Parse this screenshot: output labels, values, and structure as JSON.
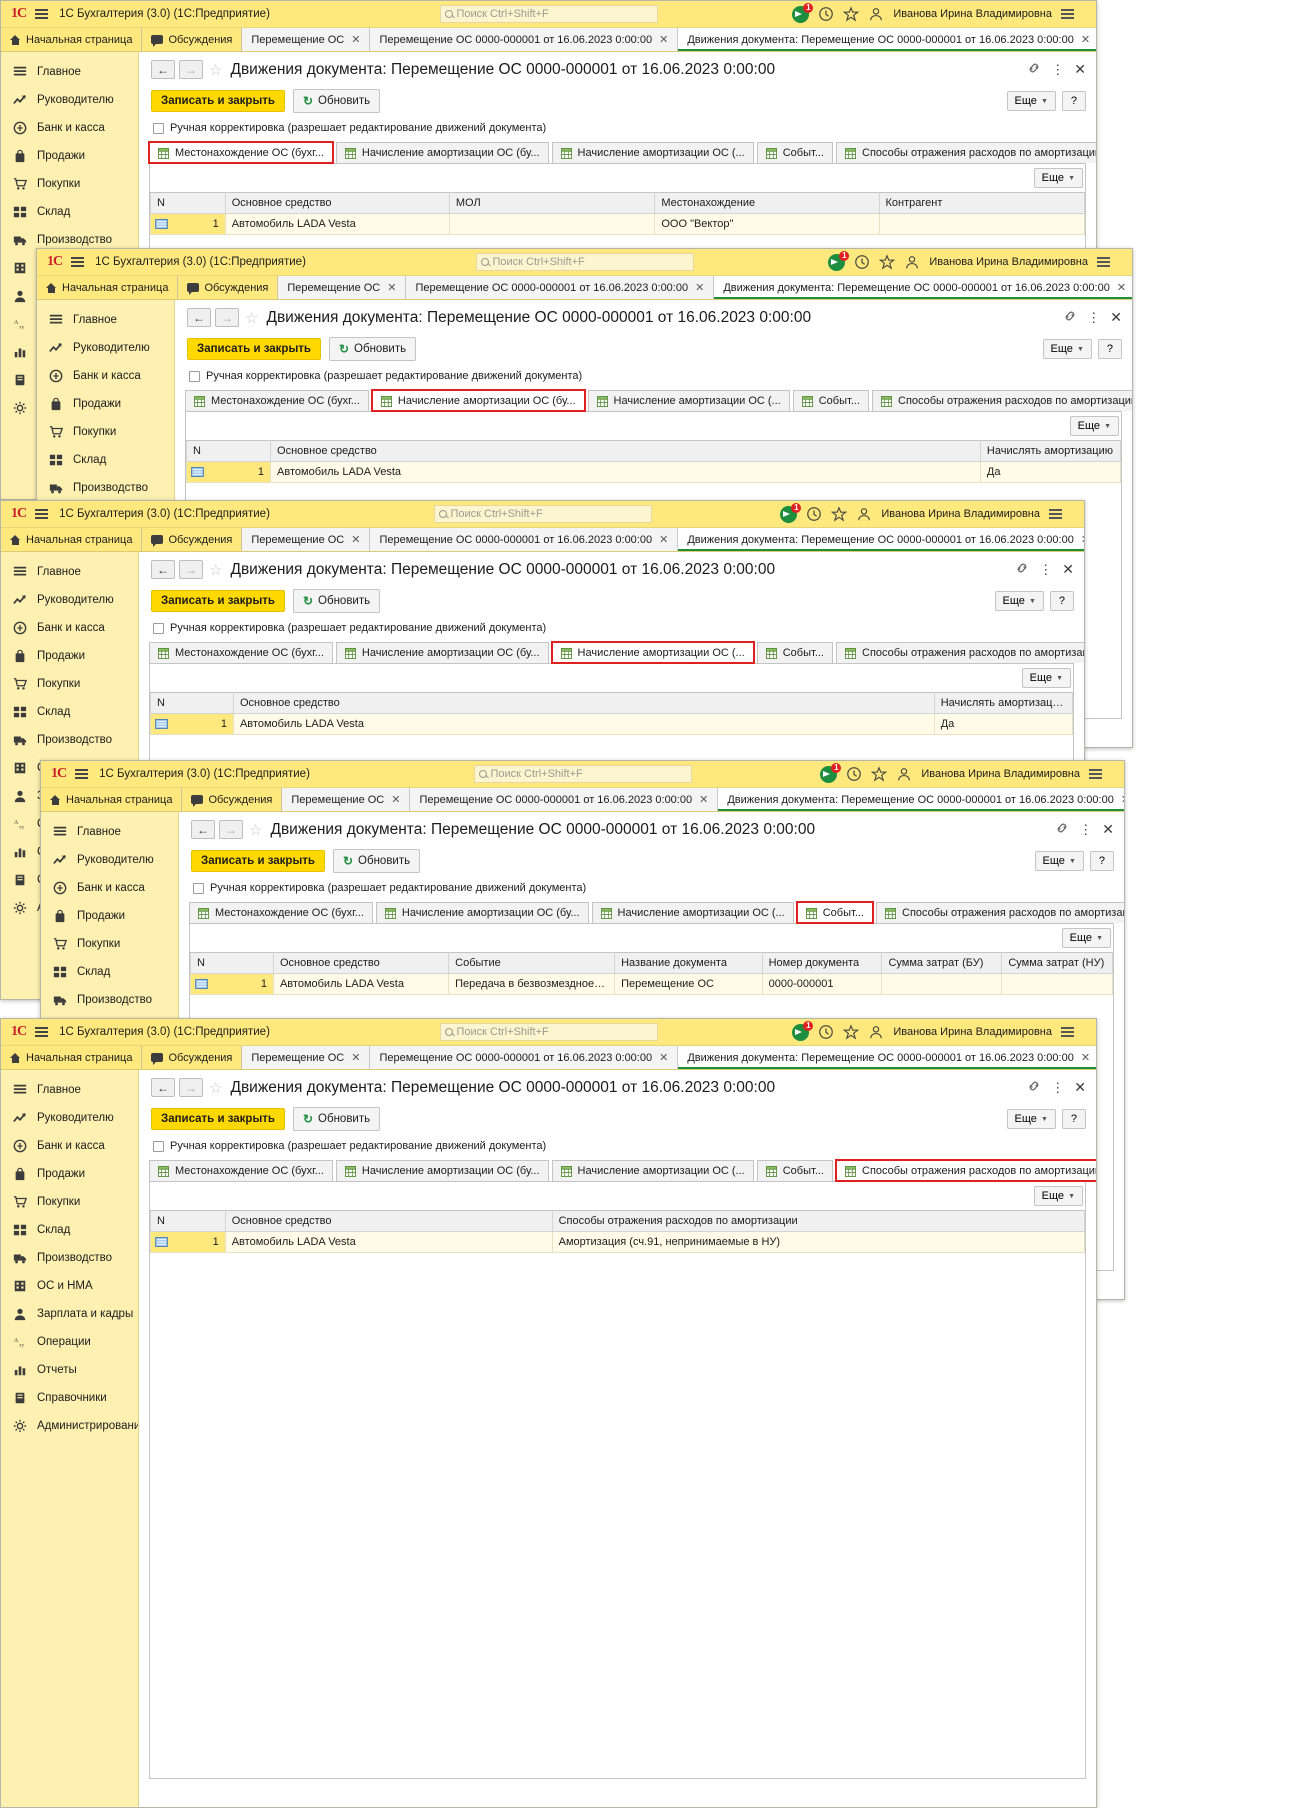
{
  "app": {
    "logo": "1C",
    "title": "1С Бухгалтерия (3.0)  (1С:Предприятие)",
    "search_placeholder": "Поиск Ctrl+Shift+F",
    "notification_count": "1",
    "username": "Иванова Ирина Владимировна",
    "icons": {
      "menu": "burger-menu-icon",
      "notification": "notification-megaphone-icon",
      "history": "history-clock-icon",
      "favorites": "star-icon",
      "user": "user-icon",
      "main_menu": "main-menu-icon"
    }
  },
  "tabs": [
    {
      "label": "Начальная страница",
      "icon": "home-icon",
      "closable": false,
      "state": "plain"
    },
    {
      "label": "Обсуждения",
      "icon": "chat-icon",
      "closable": false,
      "state": "plain"
    },
    {
      "label": "Перемещение ОС",
      "icon": "",
      "closable": true,
      "state": "page"
    },
    {
      "label": "Перемещение ОС 0000-000001 от 16.06.2023 0:00:00",
      "icon": "",
      "closable": true,
      "state": "page"
    },
    {
      "label": "Движения документа: Перемещение ОС 0000-000001 от 16.06.2023 0:00:00",
      "icon": "",
      "closable": true,
      "state": "active"
    }
  ],
  "sidebar": {
    "items": [
      {
        "label": "Главное",
        "icon": "list-icon"
      },
      {
        "label": "Руководителю",
        "icon": "trend-up-icon"
      },
      {
        "label": "Банк и касса",
        "icon": "coin-icon"
      },
      {
        "label": "Продажи",
        "icon": "bag-icon"
      },
      {
        "label": "Покупки",
        "icon": "cart-icon"
      },
      {
        "label": "Склад",
        "icon": "boxes-icon"
      },
      {
        "label": "Производство",
        "icon": "truck-icon"
      },
      {
        "label": "ОС и НМА",
        "icon": "building-icon"
      },
      {
        "label": "Зарплата и кадры",
        "icon": "person-icon"
      },
      {
        "label": "Операции",
        "icon": "operations-icon"
      },
      {
        "label": "Отчеты",
        "icon": "bar-chart-icon"
      },
      {
        "label": "Справочники",
        "icon": "book-icon"
      },
      {
        "label": "Администрирование",
        "icon": "gear-icon"
      }
    ]
  },
  "form": {
    "title": "Движения документа: Перемещение ОС 0000-000001 от 16.06.2023 0:00:00",
    "nav_back": "←",
    "nav_forward": "→",
    "favorite_star": "☆",
    "link_icon": "link-icon",
    "more_menu_icon": "⋮",
    "close_icon": "✕",
    "save_and_close": "Записать и закрыть",
    "refresh": "Обновить",
    "more_label": "Еще",
    "help_label": "?",
    "manual_correction": "Ручная корректировка (разрешает редактирование движений документа)"
  },
  "register_tabs": [
    "Местонахождение ОС (бухг...",
    "Начисление амортизации ОС (бу...",
    "Начисление амортизации ОС (...",
    "事Событ...",
    "Способы отражения расходов по амортизации ..."
  ],
  "register_tabs_fixed": [
    "Местонахождение ОС (бухг...",
    "Начисление амортизации ОС (бу...",
    "Начисление амортизации ОС (...",
    "Событ...",
    "Способы отражения расходов по амортизации ..."
  ],
  "windows": [
    {
      "id": "window-1",
      "selected_register_index": 0,
      "table": {
        "columns": [
          "N",
          "Основное средство",
          "МОЛ",
          "Местонахождение",
          "Контрагент"
        ],
        "widths": [
          "8%",
          "24%",
          "22%",
          "24%",
          "22%"
        ],
        "rows": [
          {
            "n": "1",
            "cells": [
              "Автомобиль LADA Vesta",
              "",
              "ООО \"Вектор\"",
              ""
            ]
          }
        ]
      }
    },
    {
      "id": "window-2",
      "selected_register_index": 1,
      "table": {
        "columns": [
          "N",
          "Основное средство",
          "Начислять амортизацию"
        ],
        "widths": [
          "9%",
          "76%",
          "15%"
        ],
        "rows": [
          {
            "n": "1",
            "cells": [
              "Автомобиль LADA Vesta",
              "Да"
            ]
          }
        ]
      }
    },
    {
      "id": "window-3",
      "selected_register_index": 2,
      "table": {
        "columns": [
          "N",
          "Основное средство",
          "Начислять амортизацию"
        ],
        "widths": [
          "9%",
          "76%",
          "15%"
        ],
        "rows": [
          {
            "n": "1",
            "cells": [
              "Автомобиль LADA Vesta",
              "Да"
            ]
          }
        ]
      }
    },
    {
      "id": "window-4",
      "selected_register_index": 3,
      "table": {
        "columns": [
          "N",
          "Основное средство",
          "Событие",
          "Название документа",
          "Номер документа",
          "Сумма затрат (БУ)",
          "Сумма затрат (НУ)"
        ],
        "widths": [
          "9%",
          "19%",
          "18%",
          "16%",
          "13%",
          "13%",
          "12%"
        ],
        "rows": [
          {
            "n": "1",
            "cells": [
              "Автомобиль LADA Vesta",
              "Передача в безвозмездное по...",
              "Перемещение ОС",
              "0000-000001",
              "",
              ""
            ]
          }
        ]
      }
    },
    {
      "id": "window-5",
      "selected_register_index": 4,
      "table": {
        "columns": [
          "N",
          "Основное средство",
          "Способы отражения расходов по амортизации"
        ],
        "widths": [
          "8%",
          "35%",
          "57%"
        ],
        "rows": [
          {
            "n": "1",
            "cells": [
              "Автомобиль LADA Vesta",
              "Амортизация (сч.91, непринимаемые в НУ)"
            ]
          }
        ]
      }
    }
  ],
  "colors": {
    "accent_yellow": "#ffe97f",
    "button_yellow": "#ffd800",
    "highlight_red": "#e02020",
    "active_tab_green": "#1d8d3e",
    "brand_red": "#c8202a"
  }
}
